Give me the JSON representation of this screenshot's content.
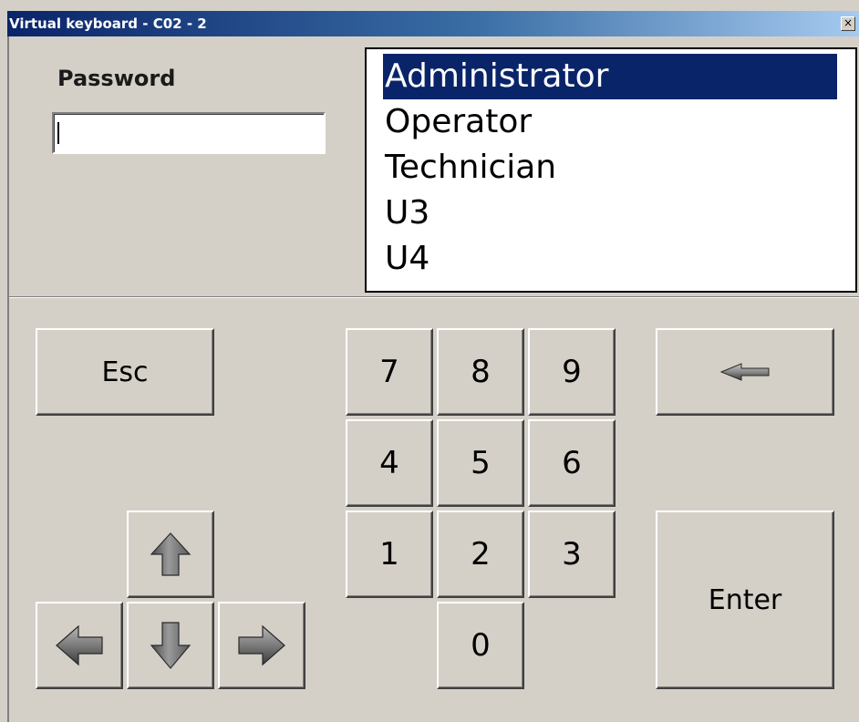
{
  "window": {
    "title": "Virtual keyboard - C02 - 2",
    "close_glyph": "×"
  },
  "password": {
    "label": "Password",
    "value": ""
  },
  "users": {
    "items": [
      "Administrator",
      "Operator",
      "Technician",
      "U3",
      "U4"
    ],
    "selected": "Administrator"
  },
  "keys": {
    "esc": "Esc",
    "enter": "Enter",
    "digits": [
      "7",
      "8",
      "9",
      "4",
      "5",
      "6",
      "1",
      "2",
      "3",
      "0"
    ]
  },
  "icons": {
    "backspace": "backspace-arrow-icon",
    "up": "up-arrow-icon",
    "down": "down-arrow-icon",
    "left": "left-arrow-icon",
    "right": "right-arrow-icon"
  },
  "colors": {
    "face": "#d4d0c8",
    "selection": "#0a246a",
    "title_start": "#0a246a",
    "title_end": "#a6caf0"
  }
}
